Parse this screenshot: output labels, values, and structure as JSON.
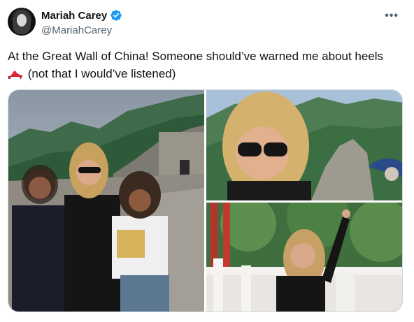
{
  "tweet": {
    "display_name": "Mariah Carey",
    "handle": "@MariahCarey",
    "verified": true,
    "text_line_1": "At the Great Wall of China! Someone should’ve warned me about heels",
    "text_line_2": "(not that I would’ve listened)",
    "emoji": "high-heel-icon"
  },
  "media": {
    "count": 3,
    "photos": [
      {
        "id": "photo-main",
        "description_icon": "photo-icon"
      },
      {
        "id": "photo-top-right",
        "description_icon": "photo-icon"
      },
      {
        "id": "photo-bottom-right",
        "description_icon": "photo-icon"
      }
    ]
  },
  "colors": {
    "text": "#0f1419",
    "secondary": "#536471",
    "verified": "#1d9bf0",
    "border": "#cfd9de"
  }
}
